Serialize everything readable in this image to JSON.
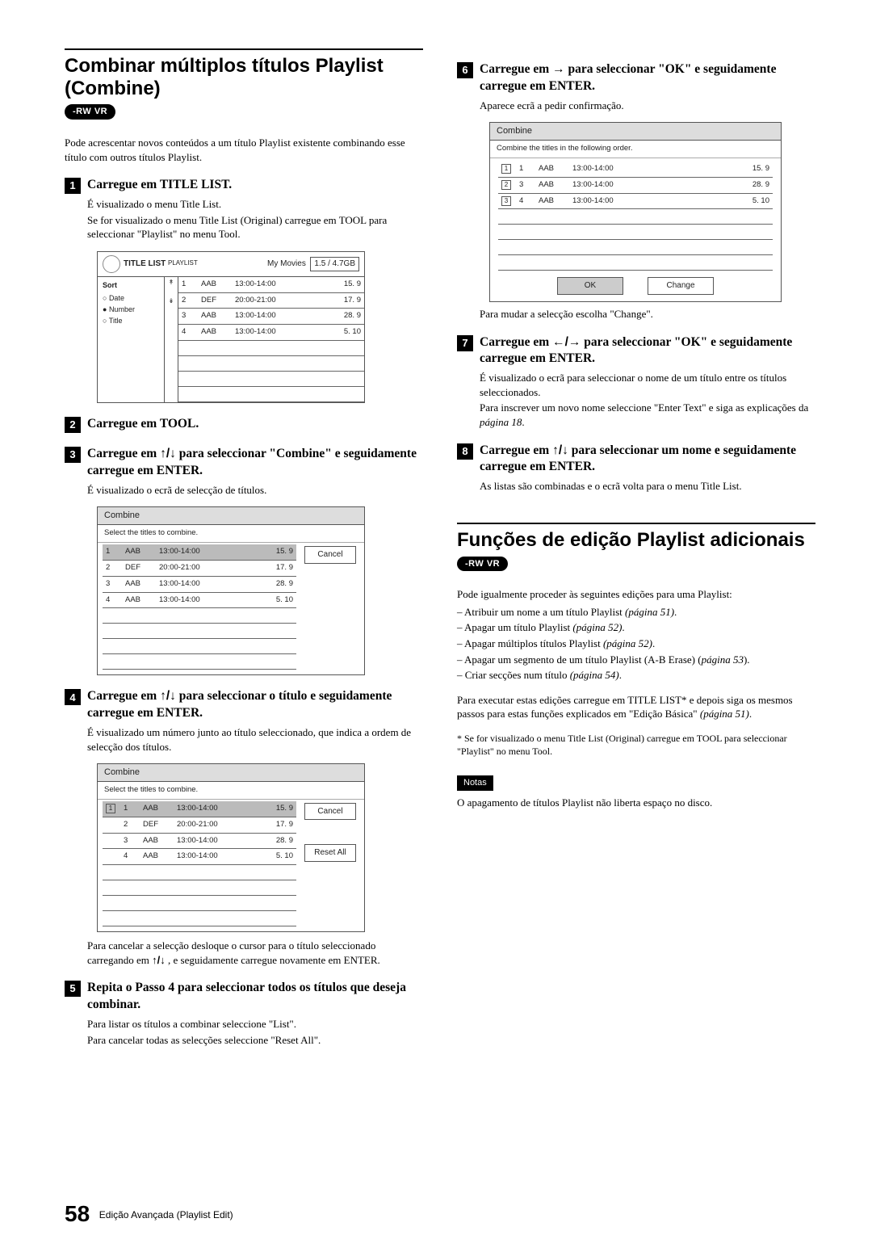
{
  "left": {
    "section_title": "Combinar múltiplos títulos Playlist (Combine)",
    "badge": "-RW VR",
    "intro": "Pode acrescentar novos conteúdos a um título Playlist existente combinando esse título com outros títulos Playlist.",
    "step1": {
      "title": "Carregue em TITLE LIST.",
      "l1": "É visualizado o menu Title List.",
      "l2": "Se for visualizado o menu Title List (Original) carregue em TOOL para seleccionar \"Playlist\" no menu Tool."
    },
    "title_list_ui": {
      "header_label": "TITLE LIST",
      "header_sub": "PLAYLIST",
      "header_right1": "My Movies",
      "header_right2": "1.5 / 4.7GB",
      "sort_label": "Sort",
      "opts": [
        "Date",
        "Number",
        "Title"
      ],
      "rows": [
        {
          "n": "1",
          "t": "AAB",
          "time": "13:00-14:00",
          "d": "15. 9"
        },
        {
          "n": "2",
          "t": "DEF",
          "time": "20:00-21:00",
          "d": "17. 9"
        },
        {
          "n": "3",
          "t": "AAB",
          "time": "13:00-14:00",
          "d": "28. 9"
        },
        {
          "n": "4",
          "t": "AAB",
          "time": "13:00-14:00",
          "d": "5. 10"
        }
      ]
    },
    "step2_title": "Carregue em TOOL.",
    "step3": {
      "title_a": "Carregue em ",
      "title_b": " para seleccionar \"Combine\" e seguidamente carregue em ENTER.",
      "l1": "É visualizado o ecrã de selecção de títulos."
    },
    "combine_ui1": {
      "title": "Combine",
      "sub": "Select the titles to combine.",
      "btn_cancel": "Cancel",
      "rows": [
        {
          "n": "1",
          "t": "AAB",
          "time": "13:00-14:00",
          "d": "15. 9",
          "sel": true
        },
        {
          "n": "2",
          "t": "DEF",
          "time": "20:00-21:00",
          "d": "17. 9"
        },
        {
          "n": "3",
          "t": "AAB",
          "time": "13:00-14:00",
          "d": "28. 9"
        },
        {
          "n": "4",
          "t": "AAB",
          "time": "13:00-14:00",
          "d": "5. 10"
        }
      ]
    },
    "step4": {
      "title_a": "Carregue em ",
      "title_b": " para seleccionar o título e seguidamente carregue em ENTER.",
      "l1": "É visualizado um número junto ao título seleccionado, que indica a ordem de selecção dos títulos."
    },
    "combine_ui2": {
      "title": "Combine",
      "sub": "Select the titles to combine.",
      "btn_cancel": "Cancel",
      "btn_reset": "Reset All",
      "rows": [
        {
          "mark": "1",
          "n": "1",
          "t": "AAB",
          "time": "13:00-14:00",
          "d": "15. 9",
          "sel": true,
          "arrow": true
        },
        {
          "n": "2",
          "t": "DEF",
          "time": "20:00-21:00",
          "d": "17. 9"
        },
        {
          "n": "3",
          "t": "AAB",
          "time": "13:00-14:00",
          "d": "28. 9"
        },
        {
          "n": "4",
          "t": "AAB",
          "time": "13:00-14:00",
          "d": "5. 10"
        }
      ]
    },
    "post4_a": "Para cancelar a selecção desloque o cursor para o título seleccionado carregando em ",
    "post4_b": " , e seguidamente carregue novamente em ENTER.",
    "step5": {
      "title": "Repita o Passo 4 para seleccionar todos os títulos que deseja combinar.",
      "l1": "Para listar os títulos a combinar seleccione \"List\".",
      "l2": "Para cancelar todas as selecções seleccione \"Reset All\"."
    }
  },
  "right": {
    "step6": {
      "title_a": "Carregue em ",
      "title_b": " para seleccionar \"OK\" e seguida­mente carregue em ENTER.",
      "l1": "Aparece ecrã a pedir confirmação."
    },
    "combine_ui3": {
      "title": "Combine",
      "sub": "Combine the titles in the following order.",
      "btn_ok": "OK",
      "btn_change": "Change",
      "rows": [
        {
          "mark": "1",
          "n": "1",
          "t": "AAB",
          "time": "13:00-14:00",
          "d": "15. 9"
        },
        {
          "mark": "2",
          "n": "3",
          "t": "AAB",
          "time": "13:00-14:00",
          "d": "28. 9"
        },
        {
          "mark": "3",
          "n": "4",
          "t": "AAB",
          "time": "13:00-14:00",
          "d": "5. 10"
        }
      ]
    },
    "post6": "Para mudar a selecção escolha \"Change\".",
    "step7": {
      "title_a": "Carregue em ",
      "title_b": " para seleccionar \"OK\" e seguidamente carregue em ENTER.",
      "l1": "É visualizado o ecrã para seleccionar o nome de um título entre os títulos seleccionados.",
      "l2a": "Para inscrever um novo nome seleccione \"Enter Text\" e siga as explicações da ",
      "l2b": "página 18",
      "l2c": "."
    },
    "step8": {
      "title_a": "Carregue em ",
      "title_b": " para seleccionar um nome e seguidamente carregue em ENTER.",
      "l1": "As listas são combinadas e o ecrã volta para o menu Title List."
    },
    "section2_title": "Funções de edição Playlist adicionais",
    "badge2": "-RW VR",
    "s2_intro": "Pode igualmente proceder às seguintes edições para uma Playlist:",
    "s2_items": [
      {
        "a": "Atribuir um nome a um título Playlist ",
        "b": "(página 51)",
        "c": "."
      },
      {
        "a": "Apagar um título Playlist ",
        "b": "(página 52)",
        "c": "."
      },
      {
        "a": "Apagar múltiplos títulos Playlist ",
        "b": "(página 52)",
        "c": "."
      },
      {
        "a": "Apagar um segmento de um título Playlist (A-B Erase) (",
        "b": "página 53",
        "c": ")."
      },
      {
        "a": "Criar secções num título ",
        "b": "(página 54)",
        "c": "."
      }
    ],
    "s2_p_a": "Para executar estas edições carregue em TITLE LIST* e depois siga os mesmos passos para estas funções explicados em \"Edição Básica\" ",
    "s2_p_b": "(página 51)",
    "s2_p_c": ".",
    "s2_note": "* Se for visualizado o menu Title List (Original) carregue em TOOL para seleccionar \"Playlist\" no menu Tool.",
    "notas_label": "Notas",
    "notas_text": "O apagamento de títulos Playlist não liberta espaço no disco."
  },
  "footer": {
    "page": "58",
    "text": "Edição Avançada (Playlist Edit)"
  }
}
